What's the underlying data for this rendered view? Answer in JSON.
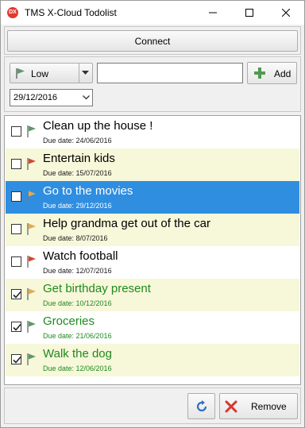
{
  "window": {
    "title": "TMS X-Cloud Todolist",
    "app_icon_text": "DX"
  },
  "toolbar": {
    "connect_label": "Connect",
    "priority_selected": "Low",
    "task_input_value": "",
    "add_label": "Add",
    "due_date_value": "29/12/2016"
  },
  "tasks": [
    {
      "title": "Clean up the house !",
      "due": "Due date: 24/06/2016",
      "done": false,
      "priority": "low",
      "selected": false
    },
    {
      "title": "Entertain kids",
      "due": "Due date: 15/07/2016",
      "done": false,
      "priority": "high",
      "selected": false
    },
    {
      "title": "Go to the movies",
      "due": "Due date: 29/12/2016",
      "done": false,
      "priority": "normal",
      "selected": true
    },
    {
      "title": "Help grandma get out of the car",
      "due": "Due date: 8/07/2016",
      "done": false,
      "priority": "normal",
      "selected": false
    },
    {
      "title": "Watch football",
      "due": "Due date: 12/07/2016",
      "done": false,
      "priority": "high",
      "selected": false
    },
    {
      "title": "Get birthday present",
      "due": "Due date: 10/12/2016",
      "done": true,
      "priority": "normal",
      "selected": false
    },
    {
      "title": "Groceries",
      "due": "Due date: 21/06/2016",
      "done": true,
      "priority": "low",
      "selected": false
    },
    {
      "title": "Walk the dog",
      "due": "Due date: 12/06/2016",
      "done": true,
      "priority": "low",
      "selected": false
    }
  ],
  "footer": {
    "remove_label": "Remove"
  },
  "colors": {
    "selection": "#2f8ee0",
    "alt_row": "#f7f7da",
    "done_text": "#1f8a1f",
    "flag_low": "#5a9a6a",
    "flag_normal": "#e8a94a",
    "flag_high": "#d9452b"
  }
}
